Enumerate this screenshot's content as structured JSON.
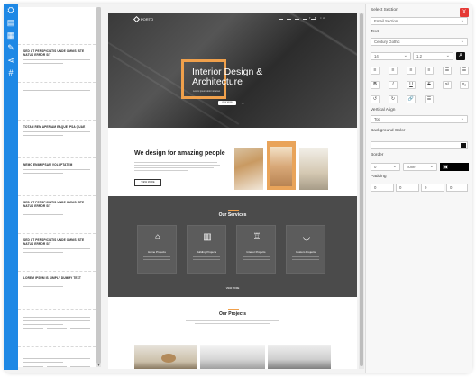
{
  "rail": {
    "icons": [
      "layout-icon",
      "grid-icon",
      "text-icon",
      "style-icon",
      "share-icon",
      "code-icon"
    ]
  },
  "thumbnails": [
    {
      "title": "",
      "lines": 0
    },
    {
      "title": "SED UT PERSPICIATIS UNDE OMNIS ISTE NATUS ERROR SIT",
      "lines": 2
    },
    {
      "title": "",
      "lines": 2
    },
    {
      "title": "TOTAM REM APERIAM EAQUE IPSA QUAE",
      "lines": 2
    },
    {
      "title": "NEMO ENIM IPSAM VOLUPTATEM",
      "lines": 2
    },
    {
      "title": "SED UT PERSPICIATIS UNDE OMNIS ISTE NATUS ERROR SIT",
      "lines": 2
    },
    {
      "title": "SED UT PERSPICIATIS UNDE OMNIS ISTE NATUS ERROR SIT",
      "lines": 2
    },
    {
      "title": "LOREM IPSUM IS SIMPLY DUMMY TEXT",
      "lines": 2
    },
    {
      "title": "",
      "lines": 3
    },
    {
      "title": "",
      "lines": 3
    }
  ],
  "preview": {
    "logo": "PORTO",
    "social": "f ♥ in",
    "hero_title": "Interior Design &\nArchitecture",
    "hero_sub": "Lorem ipsum dolor sit amet",
    "hero_btn": "VIEW MORE",
    "about_title": "We design for amazing people",
    "about_btn": "VIEW MORE",
    "services_title": "Our Services",
    "services": [
      {
        "name": "Home Projects",
        "icon": "home-icon",
        "glyph": "⌂"
      },
      {
        "name": "Building Projects",
        "icon": "building-icon",
        "glyph": "▥"
      },
      {
        "name": "Interior Projects",
        "icon": "chair-icon",
        "glyph": "♖"
      },
      {
        "name": "Custom Projects",
        "icon": "bathtub-icon",
        "glyph": "◡"
      }
    ],
    "services_more": "VIEW MORE",
    "projects_title": "Our Projects"
  },
  "panel": {
    "select_section_label": "Select Section",
    "close_label": "X",
    "section_value": "Email Section",
    "text_label": "Text",
    "font_value": "Century Gothic",
    "size_value": "14",
    "line_height_value": "1.2",
    "toolbar_row1": [
      "≡",
      "≡",
      "≡",
      "≡",
      "☰",
      "☰"
    ],
    "toolbar_row2": [
      "B",
      "I",
      "U",
      "S",
      "x²",
      "x₂"
    ],
    "toolbar_row3": [
      "↺",
      "↻",
      "🔗",
      "☰"
    ],
    "vertical_align_label": "Vertical Align",
    "vertical_align_value": "Top",
    "bg_color_label": "Background Color",
    "border_label": "Border",
    "border_width": "0",
    "border_style": "none",
    "padding_label": "Padding",
    "padding": [
      "0",
      "0",
      "0",
      "0"
    ]
  },
  "colors": {
    "accent": "#1e88e5",
    "brand_orange": "#f0a04b",
    "close_red": "#e53935",
    "services_bg": "#4b4b4b"
  }
}
